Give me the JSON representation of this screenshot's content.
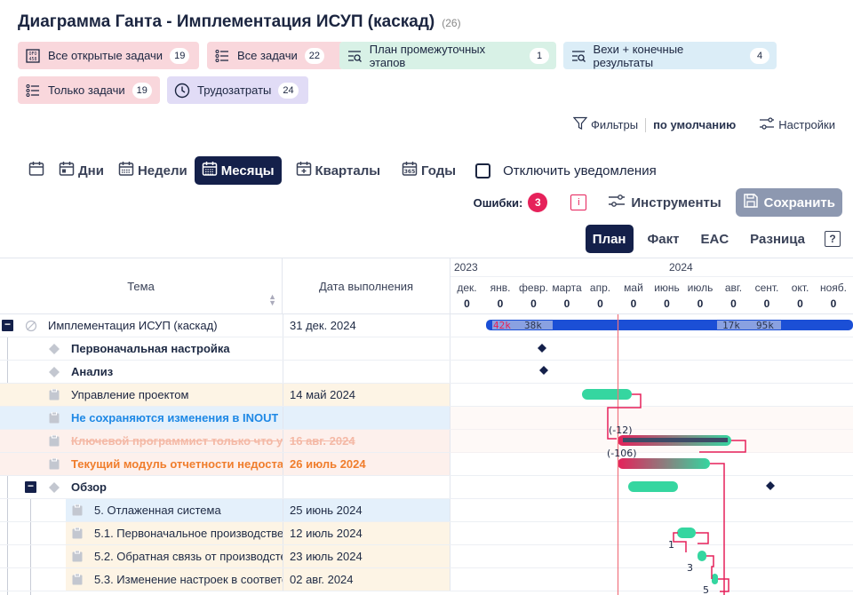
{
  "header": {
    "title": "Диаграмма Ганта - Имплементация ИСУП (каскад)",
    "count": "(26)"
  },
  "chips": [
    {
      "label": "Все открытые задачи",
      "count": "19"
    },
    {
      "label": "Все задачи",
      "count": "22"
    },
    {
      "label": "План промежуточных этапов",
      "count": "1"
    },
    {
      "label": "Вехи + конечные результаты",
      "count": "4"
    },
    {
      "label": "Только задачи",
      "count": "19"
    },
    {
      "label": "Трудозатраты",
      "count": "24"
    }
  ],
  "filters": {
    "filters_label": "Фильтры",
    "default_label": "по умолчанию",
    "settings_label": "Настройки"
  },
  "views": {
    "days": "Дни",
    "weeks": "Недели",
    "months": "Месяцы",
    "quarters": "Кварталы",
    "years": "Годы",
    "disable_notifications": "Отключить уведомления"
  },
  "tools": {
    "errors_label": "Ошибки:",
    "errors_count": "3",
    "info": "i",
    "instruments": "Инструменты",
    "save": "Сохранить"
  },
  "modes": {
    "plan": "План",
    "fact": "Факт",
    "eac": "EAC",
    "diff": "Разница",
    "help": "?"
  },
  "table": {
    "col_topic": "Тема",
    "col_date": "Дата выполнения",
    "rows": [
      {
        "topic": "Имплементация ИСУП (каскад)",
        "date": "31 дек. 2024"
      },
      {
        "topic": "Первоначальная настройка",
        "date": ""
      },
      {
        "topic": "Анализ",
        "date": ""
      },
      {
        "topic": "Управление проектом",
        "date": "14 май 2024"
      },
      {
        "topic": "Не сохраняются изменения в INOUT",
        "date": ""
      },
      {
        "topic": "Ключевой программист только что у",
        "date": "16 авг. 2024"
      },
      {
        "topic": "Текущий модуль отчетности недоста",
        "date": "26 июль 2024"
      },
      {
        "topic": "Обзор",
        "date": ""
      },
      {
        "topic": "5. Отлаженная система",
        "date": "25 июнь 2024"
      },
      {
        "topic": "5.1. Первоначальное производстве",
        "date": "12 июль 2024"
      },
      {
        "topic": "5.2. Обратная связь от производсте",
        "date": "23 июль 2024"
      },
      {
        "topic": "5.3. Изменение настроек в соответс",
        "date": "02 авг. 2024"
      }
    ]
  },
  "gantt": {
    "years": [
      "2023",
      "2024"
    ],
    "months": [
      "дек.",
      "янв.",
      "февр.",
      "марта",
      "апр.",
      "май",
      "июнь",
      "июль",
      "авг.",
      "сент.",
      "окт.",
      "нояб."
    ],
    "workload": [
      "0",
      "0",
      "0",
      "0",
      "0",
      "0",
      "0",
      "0",
      "0",
      "0",
      "0",
      "0"
    ],
    "summary_labels": [
      "42k",
      "38k",
      "17k",
      "95k"
    ],
    "dep_labels": [
      "(-12)",
      "(-106)",
      "1",
      "3",
      "5",
      "3"
    ]
  },
  "colors": {
    "accent": "#14204a",
    "summary_bar": "#1b4fd6",
    "task_bar": "#35d6a0",
    "error": "#e6215a",
    "today_line": "#f0737e"
  }
}
